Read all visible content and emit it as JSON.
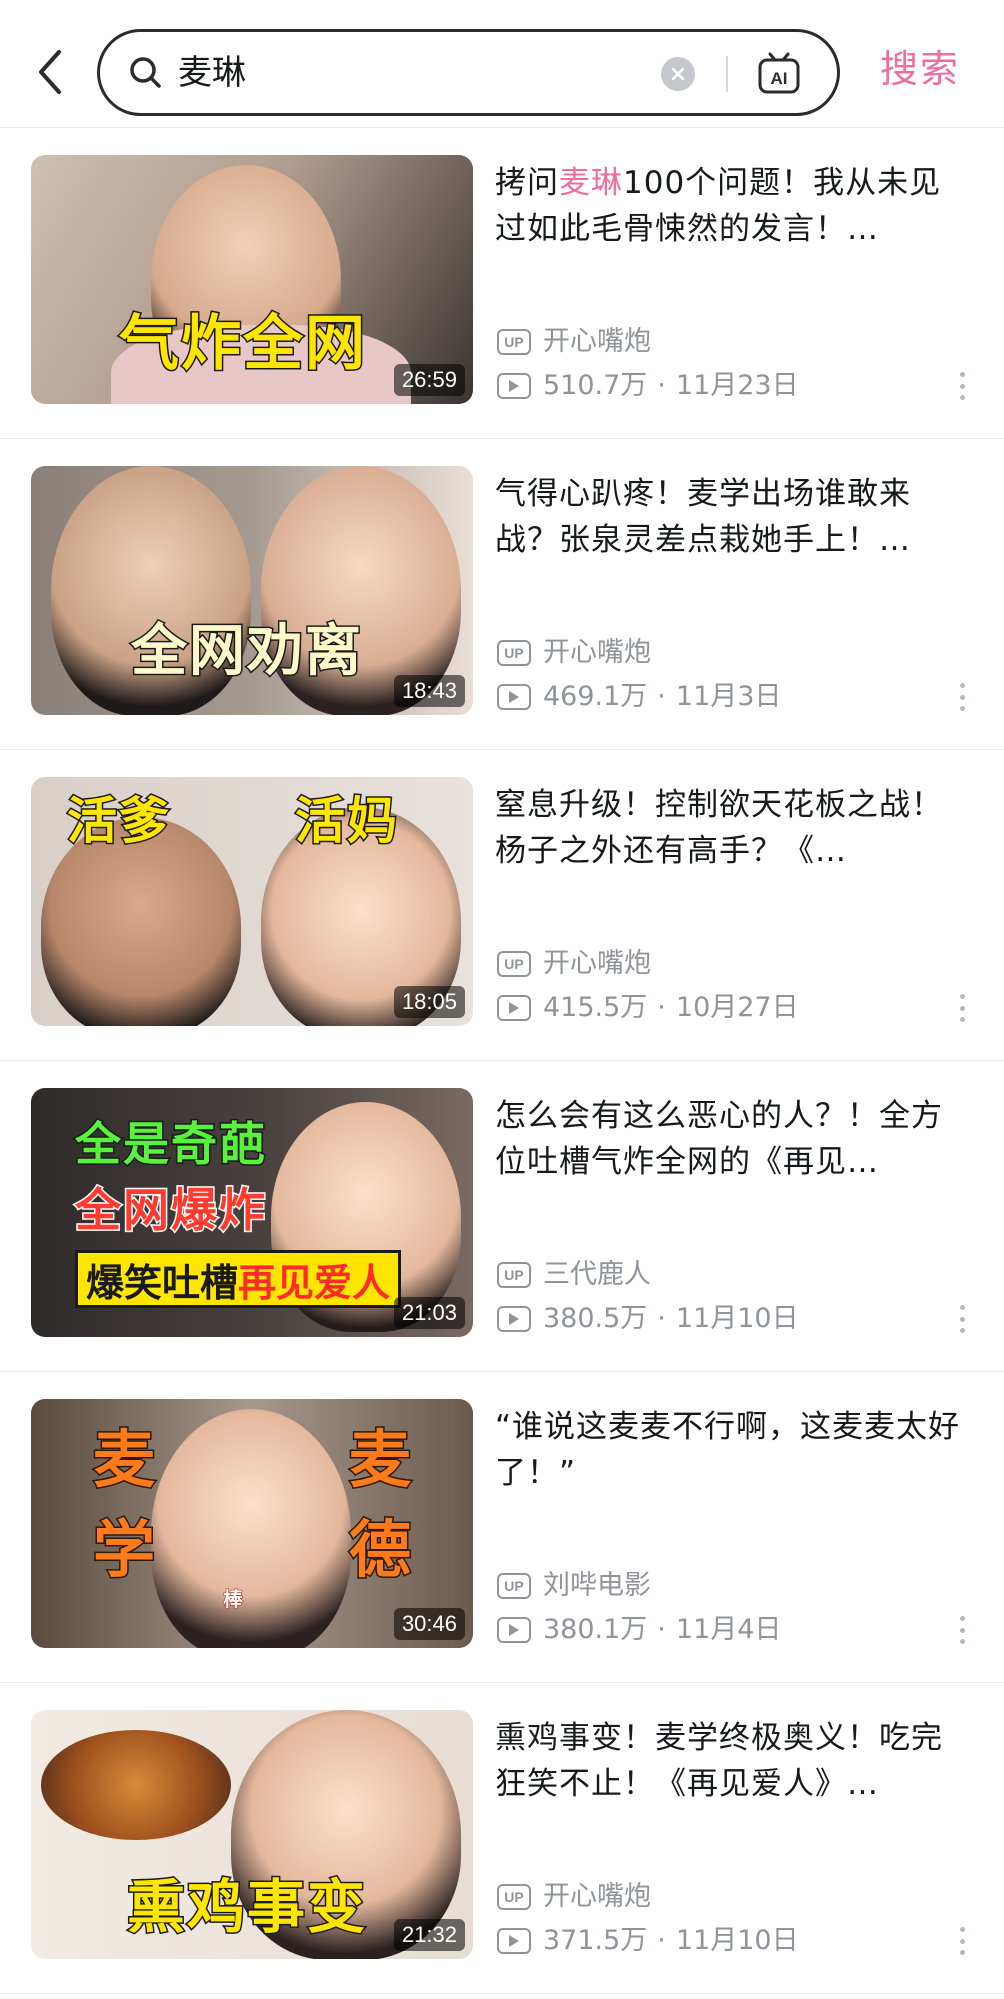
{
  "search": {
    "query": "麦琳",
    "submit_label": "搜索",
    "ai_label": "AI"
  },
  "colors": {
    "accent": "#f06c9c",
    "meta": "#8f949a",
    "overlay_yellow": "#ffe600",
    "overlay_red": "#ff3b2f"
  },
  "results": [
    {
      "title_pre": "拷问",
      "title_hl": "麦琳",
      "title_post": "100个问题！我从未见过如此毛骨悚然的发言！…",
      "author": "开心嘴炮",
      "views": "510.7万",
      "date": "11月23日",
      "duration": "26:59",
      "overlay": [
        "气炸全网"
      ]
    },
    {
      "title_pre": "气得心趴疼！麦学出场谁敢来战？张泉灵差点栽她手上！…",
      "title_hl": "",
      "title_post": "",
      "author": "开心嘴炮",
      "views": "469.1万",
      "date": "11月3日",
      "duration": "18:43",
      "overlay": [
        "全网劝离"
      ]
    },
    {
      "title_pre": "窒息升级！控制欲天花板之战！杨子之外还有高手？《…",
      "title_hl": "",
      "title_post": "",
      "author": "开心嘴炮",
      "views": "415.5万",
      "date": "10月27日",
      "duration": "18:05",
      "overlay": [
        "活爹",
        "活妈"
      ]
    },
    {
      "title_pre": "怎么会有这么恶心的人？！全方位吐槽气炸全网的《再见…",
      "title_hl": "",
      "title_post": "",
      "author": "三代鹿人",
      "views": "380.5万",
      "date": "11月10日",
      "duration": "21:03",
      "overlay": [
        "全是奇葩",
        "全网爆炸",
        "爆笑吐槽",
        "再见爱人"
      ]
    },
    {
      "title_pre": "“谁说这麦麦不行啊，这麦麦太好了！”",
      "title_hl": "",
      "title_post": "",
      "author": "刘哔电影",
      "views": "380.1万",
      "date": "11月4日",
      "duration": "30:46",
      "overlay": [
        "麦",
        "学",
        "麦",
        "德",
        "棒"
      ]
    },
    {
      "title_pre": "熏鸡事变！麦学终极奥义！吃完狂笑不止！《再见爱人》…",
      "title_hl": "",
      "title_post": "",
      "author": "开心嘴炮",
      "views": "371.5万",
      "date": "11月10日",
      "duration": "21:32",
      "overlay": [
        "熏鸡事变"
      ]
    }
  ]
}
